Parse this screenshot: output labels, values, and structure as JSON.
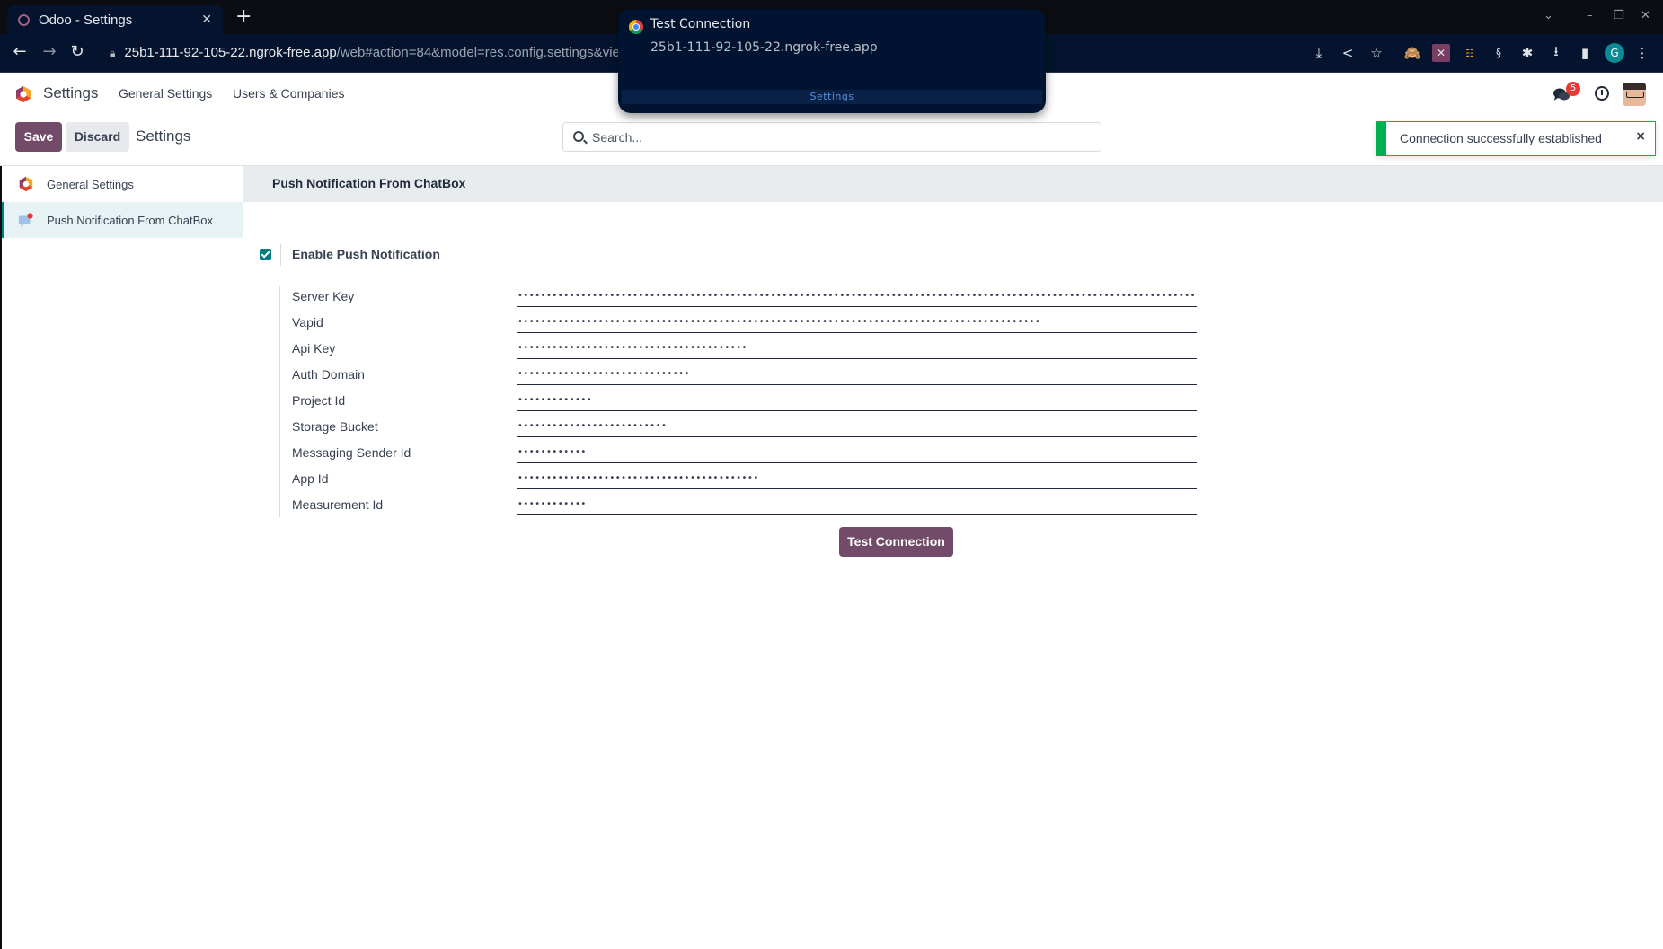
{
  "browser": {
    "tab_title": "Odoo - Settings",
    "url_host": "25b1-111-92-105-22.ngrok-free.app",
    "url_path": "/web#action=84&model=res.config.settings&view_",
    "profile_initial": "G",
    "extensions": [
      "install-app-icon",
      "share-icon",
      "bookmark-star-icon",
      "extension-monkey-icon",
      "extension-tools-icon",
      "extension-team-icon",
      "extension-s-icon",
      "extensions-puzzle-icon",
      "downloads-icon",
      "side-panel-icon"
    ]
  },
  "notification": {
    "title": "Test Connection",
    "body": "25b1-111-92-105-22.ngrok-free.app",
    "settings_label": "Settings"
  },
  "navbar": {
    "app_name": "Settings",
    "menus": [
      "General Settings",
      "Users & Companies"
    ],
    "chat_badge_count": "5"
  },
  "control_panel": {
    "save_label": "Save",
    "discard_label": "Discard",
    "title": "Settings",
    "search_placeholder": "Search..."
  },
  "toast": {
    "message": "Connection successfully established",
    "close_label": "×",
    "color": "#00b050"
  },
  "sidebar": {
    "items": [
      {
        "label": "General Settings",
        "active": false
      },
      {
        "label": "Push Notification From ChatBox",
        "active": true
      }
    ]
  },
  "section": {
    "title": "Push Notification From ChatBox",
    "enable_label": "Enable Push Notification",
    "enable_checked": true,
    "fields": [
      {
        "label": "Server Key",
        "value": "••••••••••••••••••••••••••••••••••••••••••••••••••••••••••••••••••••••••••••••••••••••••••••••••••••••••••••••••••••••••••••••••••••••••••••••••••••••••••••••"
      },
      {
        "label": "Vapid",
        "value": "•••••••••••••••••••••••••••••••••••••••••••••••••••••••••••••••••••••••••••••••••••••••••••"
      },
      {
        "label": "Api Key",
        "value": "••••••••••••••••••••••••••••••••••••••••"
      },
      {
        "label": "Auth Domain",
        "value": "••••••••••••••••••••••••••••••"
      },
      {
        "label": "Project Id",
        "value": "•••••••••••••"
      },
      {
        "label": "Storage Bucket",
        "value": "••••••••••••••••••••••••••"
      },
      {
        "label": "Messaging Sender Id",
        "value": "••••••••••••"
      },
      {
        "label": "App Id",
        "value": "••••••••••••••••••••••••••••••••••••••••••"
      },
      {
        "label": "Measurement Id",
        "value": "••••••••••••"
      }
    ],
    "test_button_label": "Test Connection"
  },
  "colors": {
    "brand": "#714b67",
    "accent": "#017e84",
    "success": "#00b050"
  }
}
